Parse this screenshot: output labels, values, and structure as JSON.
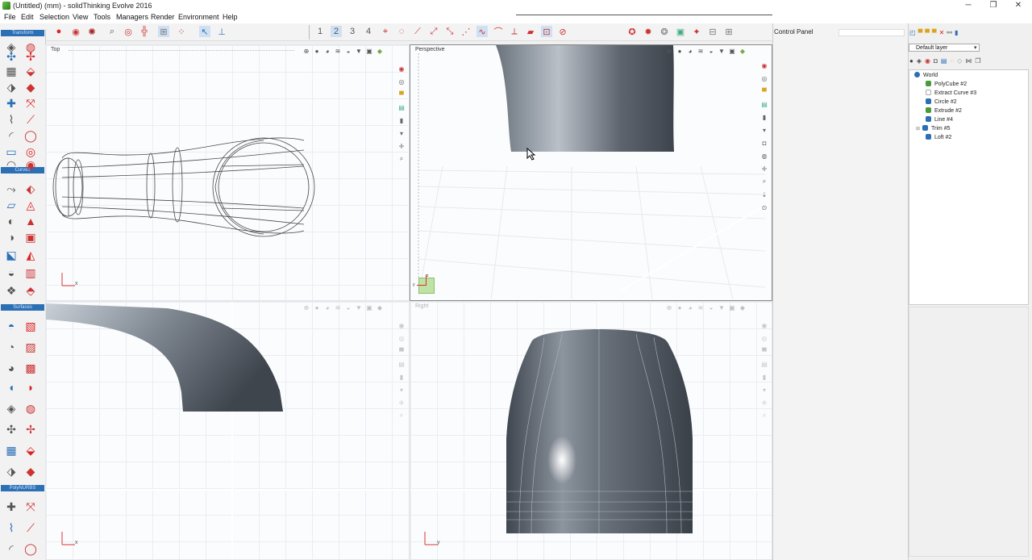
{
  "window": {
    "title": "(Untitled) (mm) - solidThinking Evolve 2016",
    "controls": {
      "minimize": "─",
      "restore": "❐",
      "close": "✕"
    }
  },
  "menu": [
    "File",
    "Edit",
    "Selection",
    "View",
    "Tools",
    "Managers",
    "Render",
    "Environment",
    "Help"
  ],
  "left_panel": {
    "groups": [
      "Transform",
      "Curves",
      "Surfaces",
      "PolyNURBS"
    ]
  },
  "viewports": {
    "top": {
      "label": "Top"
    },
    "perspective": {
      "label": "Perspective"
    },
    "front": {
      "label": ""
    },
    "right": {
      "label": "Right"
    }
  },
  "axes": {
    "x": "x",
    "y": "y",
    "z": "z"
  },
  "control_panel": {
    "title": "Control Panel"
  },
  "object_browser": {
    "layer": "Default layer",
    "root": "World",
    "items": [
      "PolyCube #2",
      "Extract Curve #3",
      "Circle #2",
      "Extrude #2",
      "Line #4",
      "Trim #5",
      "Loft #2"
    ]
  },
  "colors": {
    "accent": "#2b6fb5",
    "surface_dark": "#4e5560",
    "surface_light": "#a9b1bb"
  }
}
